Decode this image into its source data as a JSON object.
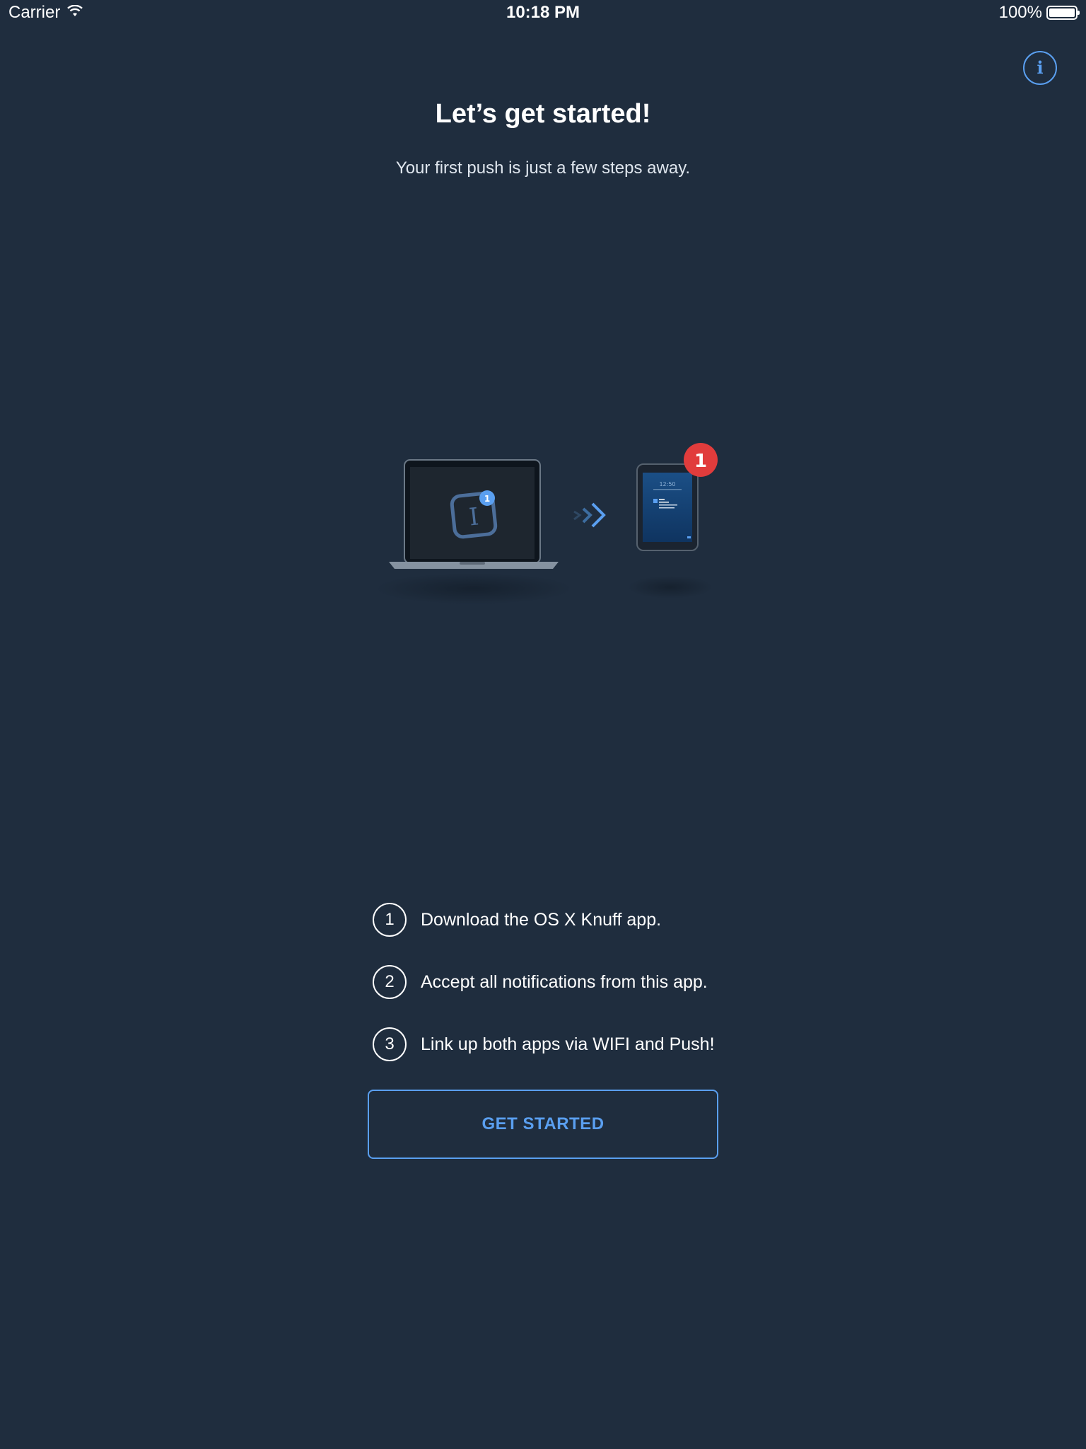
{
  "status_bar": {
    "carrier": "Carrier",
    "time": "10:18 PM",
    "battery": "100%"
  },
  "header": {
    "title": "Let’s get started!",
    "subtitle": "Your first push is just a few steps away."
  },
  "illustration": {
    "mac_badge": "1",
    "ipad_badge": "1",
    "ipad_time": "12:50"
  },
  "steps": [
    {
      "number": "1",
      "text": "Download the OS X Knuff app."
    },
    {
      "number": "2",
      "text": "Accept all notifications from this app."
    },
    {
      "number": "3",
      "text": "Link up both apps via WIFI and Push!"
    }
  ],
  "actions": {
    "get_started_label": "GET STARTED"
  },
  "colors": {
    "background": "#1f2d3e",
    "accent": "#5a9ff0",
    "badge_red": "#e13c3c"
  },
  "icons": {
    "wifi": "wifi-icon",
    "battery": "battery-icon",
    "info": "info-icon",
    "arrow": "double-chevron-right-icon"
  }
}
